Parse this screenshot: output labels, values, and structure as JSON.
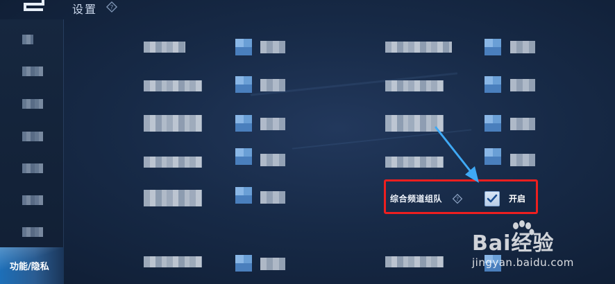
{
  "header": {
    "title": "设置"
  },
  "sidebar": {
    "active_label": "功能/隐私"
  },
  "highlight_row": {
    "label": "综合频道组队",
    "state": "开启",
    "checked": true
  },
  "watermark": {
    "brand": "Bai经验",
    "jingyan": "经验",
    "url": "jingyan.baidu.com"
  },
  "colors": {
    "highlight_border": "#ee1f1f",
    "arrow": "#3fa9f5",
    "sidebar_active": "#1d6fb8"
  }
}
